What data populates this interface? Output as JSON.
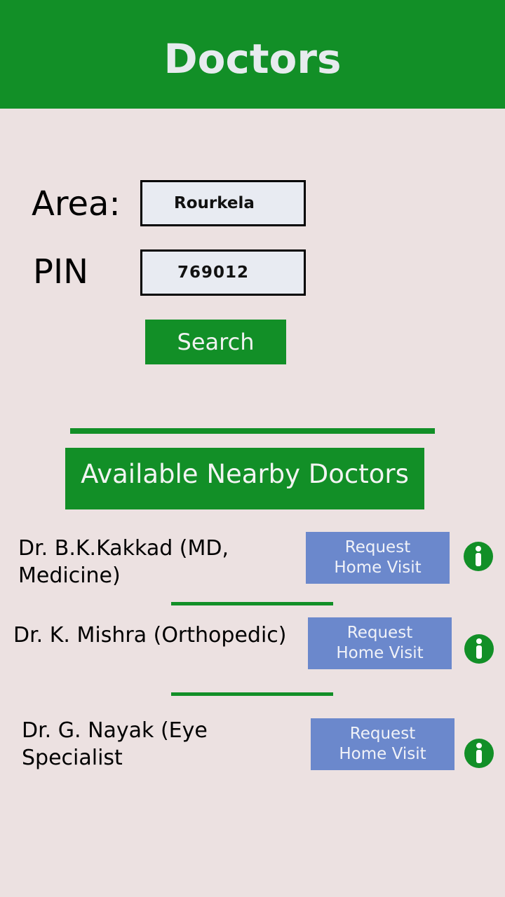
{
  "header": {
    "title": "Doctors"
  },
  "search_form": {
    "area_label": "Area:",
    "area_value": "Rourkela",
    "pin_label": "PIN",
    "pin_value": "769012",
    "search_label": "Search"
  },
  "results": {
    "heading": "Available Nearby Doctors",
    "doctors": [
      {
        "name": "Dr. B.K.Kakkad (MD, Medicine)",
        "action_label": "Request Home Visit",
        "info_icon": "info-icon"
      },
      {
        "name": "Dr. K. Mishra (Orthopedic)",
        "action_label": "Request Home Visit",
        "info_icon": "info-icon"
      },
      {
        "name": "Dr. G. Nayak (Eye Specialist",
        "action_label": "Request Home Visit",
        "info_icon": "info-icon"
      }
    ]
  },
  "colors": {
    "primary_green": "#128f27",
    "background": "#ece1e1",
    "button_blue": "#6b88cc",
    "input_bg": "#e8ebf2"
  }
}
